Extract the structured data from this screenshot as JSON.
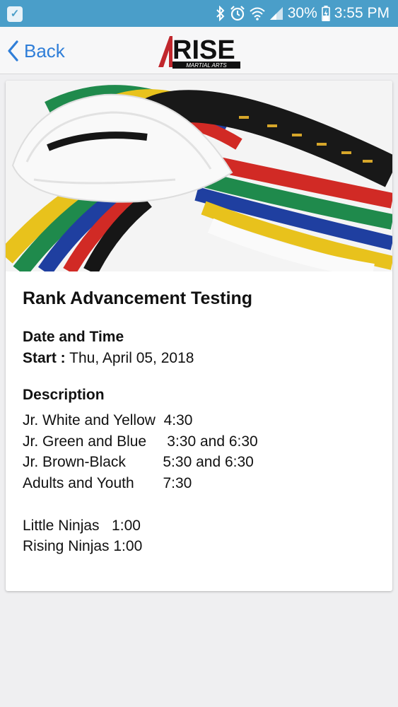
{
  "status": {
    "battery": "30%",
    "time": "3:55 PM"
  },
  "nav": {
    "back_label": "Back",
    "logo_text": "RISE",
    "logo_subtext": "MARTIAL ARTS"
  },
  "event": {
    "title": "Rank Advancement Testing",
    "date_section_label": "Date and Time",
    "start_label": "Start :",
    "start_value": "Thu, April 05, 2018",
    "description_label": "Description",
    "description_lines": [
      "Jr. White and Yellow  4:30",
      "Jr. Green and Blue     3:30 and 6:30",
      "Jr. Brown-Black         5:30 and 6:30",
      "Adults and Youth       7:30",
      "",
      "Little Ninjas   1:00",
      "Rising Ninjas 1:00"
    ]
  },
  "colors": {
    "status_bar": "#4a9ec9",
    "link_blue": "#2f7ed8",
    "page_bg": "#efeff1"
  },
  "icons": [
    "check-notification-icon",
    "bluetooth-icon",
    "alarm-icon",
    "wifi-icon",
    "signal-icon",
    "battery-icon",
    "chevron-left-icon"
  ]
}
